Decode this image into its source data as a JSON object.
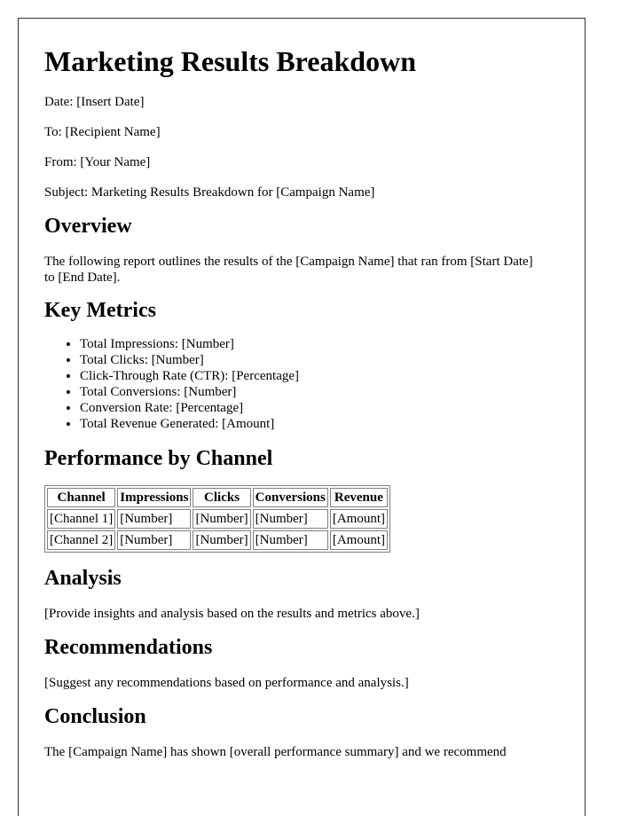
{
  "title": "Marketing Results Breakdown",
  "meta": {
    "date": "Date: [Insert Date]",
    "to": "To: [Recipient Name]",
    "from": "From: [Your Name]",
    "subject": "Subject: Marketing Results Breakdown for [Campaign Name]"
  },
  "overview": {
    "heading": "Overview",
    "text": "The following report outlines the results of the [Campaign Name] that ran from [Start Date] to [End Date]."
  },
  "key_metrics": {
    "heading": "Key Metrics",
    "items": [
      "Total Impressions: [Number]",
      "Total Clicks: [Number]",
      "Click-Through Rate (CTR): [Percentage]",
      "Total Conversions: [Number]",
      "Conversion Rate: [Percentage]",
      "Total Revenue Generated: [Amount]"
    ]
  },
  "performance": {
    "heading": "Performance by Channel",
    "columns": [
      "Channel",
      "Impressions",
      "Clicks",
      "Conversions",
      "Revenue"
    ],
    "rows": [
      [
        "[Channel 1]",
        "[Number]",
        "[Number]",
        "[Number]",
        "[Amount]"
      ],
      [
        "[Channel 2]",
        "[Number]",
        "[Number]",
        "[Number]",
        "[Amount]"
      ]
    ]
  },
  "analysis": {
    "heading": "Analysis",
    "text": "[Provide insights and analysis based on the results and metrics above.]"
  },
  "recommendations": {
    "heading": "Recommendations",
    "text": "[Suggest any recommendations based on performance and analysis.]"
  },
  "conclusion": {
    "heading": "Conclusion",
    "text": "The [Campaign Name] has shown [overall performance summary] and we recommend"
  }
}
